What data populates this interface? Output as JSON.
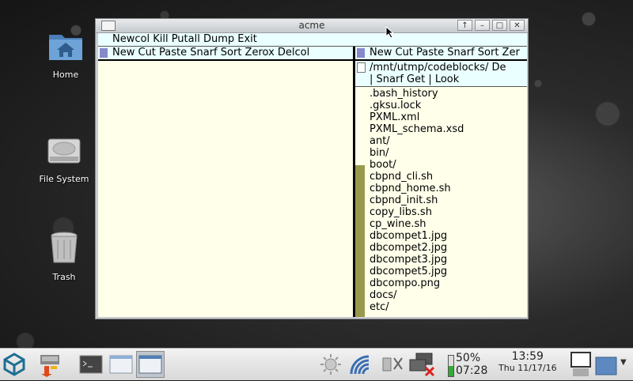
{
  "desktop": {
    "icons": [
      {
        "label": "Home"
      },
      {
        "label": "File System"
      },
      {
        "label": "Trash"
      }
    ]
  },
  "window": {
    "title": "acme",
    "buttons": [
      "↑",
      "–",
      "□",
      "✕"
    ]
  },
  "acme": {
    "row_tag": "Newcol Kill Putall Dump Exit",
    "col1_tag": "New Cut Paste Snarf Sort Zerox Delcol",
    "col2_tag": "New Cut Paste Snarf Sort Zer",
    "win_tag_line1": "/mnt/utmp/codeblocks/ De",
    "win_tag_line2": "| Snarf Get | Look",
    "files": [
      ".bash_history",
      ".gksu.lock",
      "PXML.xml",
      "PXML_schema.xsd",
      "ant/",
      "bin/",
      "boot/",
      "cbpnd_cli.sh",
      "cbpnd_home.sh",
      "cbpnd_init.sh",
      "copy_libs.sh",
      "cp_wine.sh",
      "dbcompet1.jpg",
      "dbcompet2.jpg",
      "dbcompet3.jpg",
      "dbcompet5.jpg",
      "dbcompo.png",
      "docs/",
      "etc/"
    ],
    "scroll_visible_fraction": 0.34
  },
  "taskbar": {
    "battery_percent": "50%",
    "battery_fraction": 0.5,
    "battery_time": "07:28",
    "time": "13:59",
    "date": "Thu 11/17/16"
  }
}
